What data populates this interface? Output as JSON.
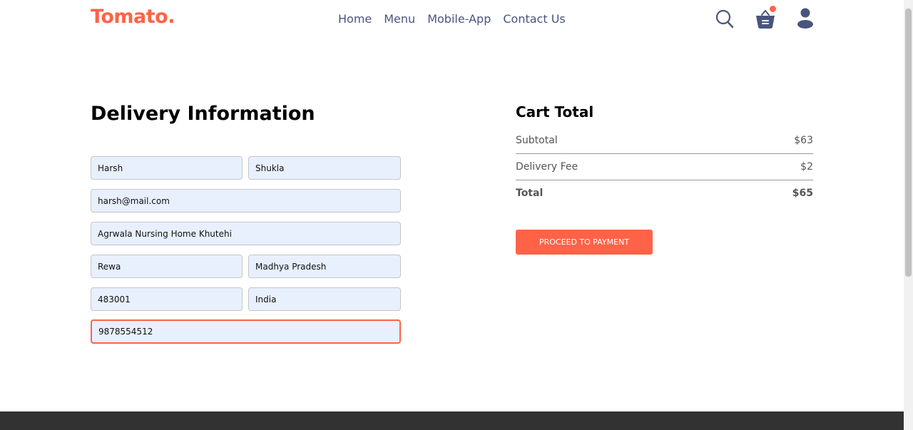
{
  "brand": {
    "logo": "Tomato."
  },
  "nav": {
    "items": [
      "Home",
      "Menu",
      "Mobile-App",
      "Contact Us"
    ]
  },
  "icons": {
    "search": "search-icon",
    "basket": "basket-icon",
    "user": "user-icon"
  },
  "delivery": {
    "title": "Delivery Information",
    "first_name": "Harsh",
    "last_name": "Shukla",
    "email": "harsh@mail.com",
    "street": "Agrwala Nursing Home Khutehi",
    "city": "Rewa",
    "state": "Madhya Pradesh",
    "zip": "483001",
    "country": "India",
    "phone": "9878554512"
  },
  "cart": {
    "title": "Cart Total",
    "subtotal_label": "Subtotal",
    "subtotal_value": "$63",
    "fee_label": "Delivery Fee",
    "fee_value": "$2",
    "total_label": "Total",
    "total_value": "$65",
    "pay_button": "PROCEED TO PAYMENT"
  },
  "colors": {
    "accent": "#ff6347",
    "nav_text": "#49557e",
    "input_bg": "#e8f0fe",
    "footer": "#323232"
  }
}
